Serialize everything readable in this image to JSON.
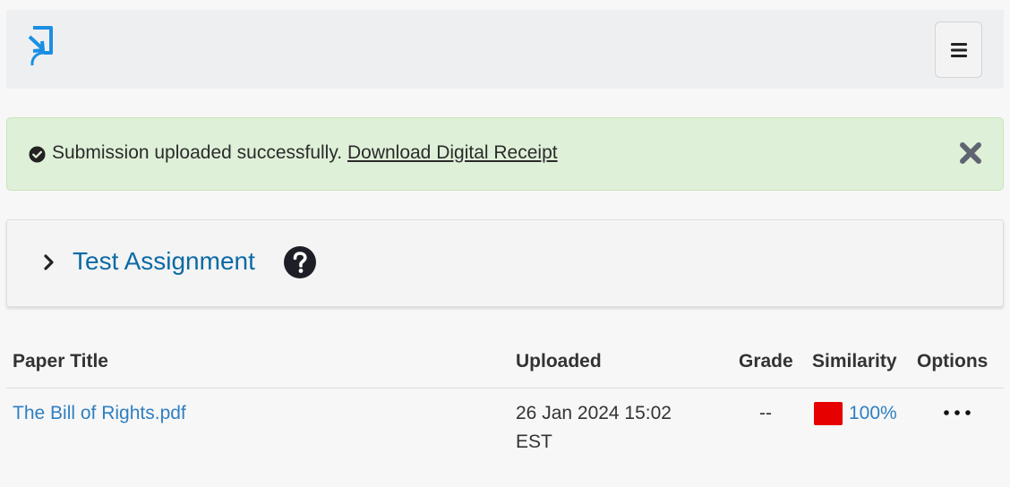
{
  "header": {
    "logo_icon": "turnitin-arrow-logo-icon",
    "menu_icon": "hamburger-menu-icon"
  },
  "alert": {
    "message": "Submission uploaded successfully.",
    "link_text": "Download Digital Receipt",
    "icon": "check-circle-icon",
    "close_icon": "close-x-icon",
    "background": "#dff0d8"
  },
  "assignment": {
    "title": "Test Assignment",
    "expand_icon": "chevron-right-icon",
    "help_icon": "question-circle-icon"
  },
  "table": {
    "headers": {
      "paper_title": "Paper Title",
      "uploaded": "Uploaded",
      "grade": "Grade",
      "similarity": "Similarity",
      "options": "Options"
    },
    "rows": [
      {
        "paper_title": "The Bill of Rights.pdf",
        "uploaded_line1": "26 Jan 2024 15:02",
        "uploaded_line2": "EST",
        "grade": "--",
        "similarity": "100%",
        "similarity_color": "#e60000",
        "options_icon": "more-horizontal-icon"
      }
    ]
  },
  "colors": {
    "link": "#2f7fc1",
    "title": "#0b6aa5",
    "logo": "#1a8fe3"
  }
}
